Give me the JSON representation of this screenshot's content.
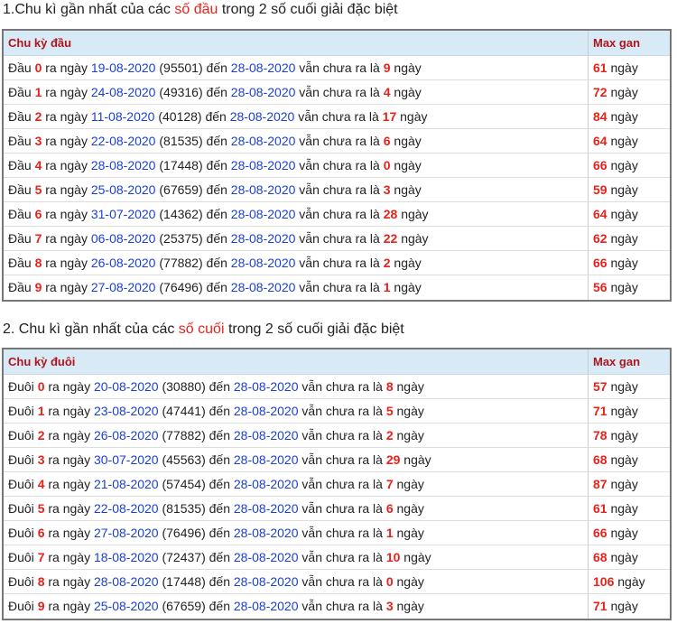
{
  "section1": {
    "title_pre": "1.Chu kì gần nhất của các ",
    "title_hl": "số đầu",
    "title_post": " trong 2 số cuối giải đặc biệt",
    "header_col1": "Chu kỳ đầu",
    "header_col2": "Max gan",
    "rows": [
      {
        "label": "Đầu",
        "digit": "0",
        "date": "19-08-2020",
        "code": "(95501)",
        "end": "28-08-2020",
        "days": "9",
        "max": "61"
      },
      {
        "label": "Đầu",
        "digit": "1",
        "date": "24-08-2020",
        "code": "(49316)",
        "end": "28-08-2020",
        "days": "4",
        "max": "72"
      },
      {
        "label": "Đầu",
        "digit": "2",
        "date": "11-08-2020",
        "code": "(40128)",
        "end": "28-08-2020",
        "days": "17",
        "max": "84"
      },
      {
        "label": "Đầu",
        "digit": "3",
        "date": "22-08-2020",
        "code": "(81535)",
        "end": "28-08-2020",
        "days": "6",
        "max": "64"
      },
      {
        "label": "Đầu",
        "digit": "4",
        "date": "28-08-2020",
        "code": "(17448)",
        "end": "28-08-2020",
        "days": "0",
        "max": "66"
      },
      {
        "label": "Đầu",
        "digit": "5",
        "date": "25-08-2020",
        "code": "(67659)",
        "end": "28-08-2020",
        "days": "3",
        "max": "59"
      },
      {
        "label": "Đầu",
        "digit": "6",
        "date": "31-07-2020",
        "code": "(14362)",
        "end": "28-08-2020",
        "days": "28",
        "max": "64"
      },
      {
        "label": "Đầu",
        "digit": "7",
        "date": "06-08-2020",
        "code": "(25375)",
        "end": "28-08-2020",
        "days": "22",
        "max": "62"
      },
      {
        "label": "Đầu",
        "digit": "8",
        "date": "26-08-2020",
        "code": "(77882)",
        "end": "28-08-2020",
        "days": "2",
        "max": "66"
      },
      {
        "label": "Đầu",
        "digit": "9",
        "date": "27-08-2020",
        "code": "(76496)",
        "end": "28-08-2020",
        "days": "1",
        "max": "56"
      }
    ]
  },
  "section2": {
    "title_pre": "2. Chu kì gần nhất của các ",
    "title_hl": "số cuối",
    "title_post": " trong 2 số cuối giải đặc biệt",
    "header_col1": "Chu kỳ đuôi",
    "header_col2": "Max gan",
    "rows": [
      {
        "label": "Đuôi",
        "digit": "0",
        "date": "20-08-2020",
        "code": "(30880)",
        "end": "28-08-2020",
        "days": "8",
        "max": "57"
      },
      {
        "label": "Đuôi",
        "digit": "1",
        "date": "23-08-2020",
        "code": "(47441)",
        "end": "28-08-2020",
        "days": "5",
        "max": "71"
      },
      {
        "label": "Đuôi",
        "digit": "2",
        "date": "26-08-2020",
        "code": "(77882)",
        "end": "28-08-2020",
        "days": "2",
        "max": "78"
      },
      {
        "label": "Đuôi",
        "digit": "3",
        "date": "30-07-2020",
        "code": "(45563)",
        "end": "28-08-2020",
        "days": "29",
        "max": "68"
      },
      {
        "label": "Đuôi",
        "digit": "4",
        "date": "21-08-2020",
        "code": "(57454)",
        "end": "28-08-2020",
        "days": "7",
        "max": "87"
      },
      {
        "label": "Đuôi",
        "digit": "5",
        "date": "22-08-2020",
        "code": "(81535)",
        "end": "28-08-2020",
        "days": "6",
        "max": "61"
      },
      {
        "label": "Đuôi",
        "digit": "6",
        "date": "27-08-2020",
        "code": "(76496)",
        "end": "28-08-2020",
        "days": "1",
        "max": "66"
      },
      {
        "label": "Đuôi",
        "digit": "7",
        "date": "18-08-2020",
        "code": "(72437)",
        "end": "28-08-2020",
        "days": "10",
        "max": "68"
      },
      {
        "label": "Đuôi",
        "digit": "8",
        "date": "28-08-2020",
        "code": "(17448)",
        "end": "28-08-2020",
        "days": "0",
        "max": "106"
      },
      {
        "label": "Đuôi",
        "digit": "9",
        "date": "25-08-2020",
        "code": "(67659)",
        "end": "28-08-2020",
        "days": "3",
        "max": "71"
      }
    ]
  },
  "words": {
    "ra_ngay": "ra ngày",
    "den": "đến",
    "van_chua": "vẫn chưa ra là",
    "ngay": "ngày"
  },
  "colors": {
    "highlight": "#e8221b",
    "date": "#1a3fd6",
    "header_bg": "#d9eaf7",
    "header_text": "#b0141c"
  }
}
